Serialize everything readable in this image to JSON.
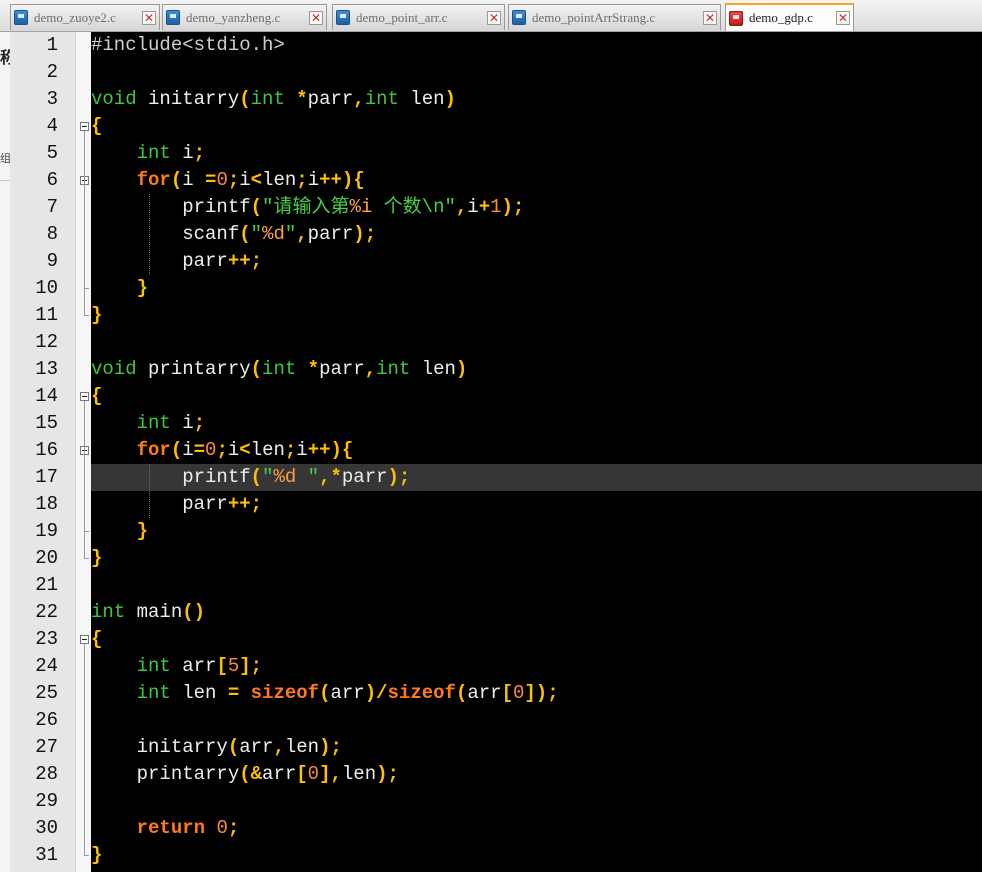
{
  "tabs": [
    {
      "label": "demo_zuoye2.c",
      "icon": "c-file-icon",
      "color": "#2a73bf",
      "active": false
    },
    {
      "label": "demo_yanzheng.c",
      "icon": "c-file-icon",
      "color": "#2a73bf",
      "active": false
    },
    {
      "label": "demo_point_arr.c",
      "icon": "c-file-icon",
      "color": "#2a73bf",
      "active": false
    },
    {
      "label": "demo_pointArrStrang.c",
      "icon": "c-file-icon",
      "color": "#2a73bf",
      "active": false
    },
    {
      "label": "demo_gdp.c",
      "icon": "c-file-icon-modified",
      "color": "#d22b2b",
      "active": true
    }
  ],
  "editor": {
    "current_line": 17,
    "theme": {
      "background": "#000000",
      "type": "#3ec73e",
      "keyword": "#ff7a1a",
      "operator": "#ffc000",
      "number": "#ff8a3a",
      "string": "#46d046"
    },
    "lines": [
      {
        "n": "1",
        "tokens": [
          [
            "#include<stdio.h>",
            "pp"
          ]
        ]
      },
      {
        "n": "2",
        "tokens": []
      },
      {
        "n": "3",
        "tokens": [
          [
            "void",
            "ty"
          ],
          [
            " initarry",
            "id"
          ],
          [
            "(",
            "op"
          ],
          [
            "int",
            "ty"
          ],
          [
            " ",
            "id"
          ],
          [
            "*",
            "op"
          ],
          [
            "parr",
            "id"
          ],
          [
            ",",
            "op"
          ],
          [
            "int",
            "ty"
          ],
          [
            " len",
            "id"
          ],
          [
            ")",
            "op"
          ]
        ]
      },
      {
        "n": "4",
        "tokens": [
          [
            "{",
            "op"
          ]
        ]
      },
      {
        "n": "5",
        "tokens": [
          [
            "    ",
            "id"
          ],
          [
            "int",
            "ty"
          ],
          [
            " i",
            "id"
          ],
          [
            ";",
            "op"
          ]
        ]
      },
      {
        "n": "6",
        "tokens": [
          [
            "    ",
            "id"
          ],
          [
            "for",
            "kw"
          ],
          [
            "(",
            "op"
          ],
          [
            "i ",
            "id"
          ],
          [
            "=",
            "op"
          ],
          [
            "0",
            "nm"
          ],
          [
            ";",
            "op"
          ],
          [
            "i",
            "id"
          ],
          [
            "<",
            "op"
          ],
          [
            "len",
            "id"
          ],
          [
            ";",
            "op"
          ],
          [
            "i",
            "id"
          ],
          [
            "++",
            "op"
          ],
          [
            ")",
            "op"
          ],
          [
            "{",
            "op"
          ]
        ]
      },
      {
        "n": "7",
        "tokens": [
          [
            "        printf",
            "id"
          ],
          [
            "(",
            "op"
          ],
          [
            "\"请输入第",
            "st"
          ],
          [
            "%i",
            "sf"
          ],
          [
            " 个数\\n\"",
            "st"
          ],
          [
            ",",
            "op"
          ],
          [
            "i",
            "id"
          ],
          [
            "+",
            "op"
          ],
          [
            "1",
            "nm"
          ],
          [
            ")",
            "op"
          ],
          [
            ";",
            "op"
          ]
        ]
      },
      {
        "n": "8",
        "tokens": [
          [
            "        scanf",
            "id"
          ],
          [
            "(",
            "op"
          ],
          [
            "\"",
            "st"
          ],
          [
            "%d",
            "sf"
          ],
          [
            "\"",
            "st"
          ],
          [
            ",",
            "op"
          ],
          [
            "parr",
            "id"
          ],
          [
            ")",
            "op"
          ],
          [
            ";",
            "op"
          ]
        ]
      },
      {
        "n": "9",
        "tokens": [
          [
            "        parr",
            "id"
          ],
          [
            "++",
            "op"
          ],
          [
            ";",
            "op"
          ]
        ]
      },
      {
        "n": "10",
        "tokens": [
          [
            "    ",
            "id"
          ],
          [
            "}",
            "op"
          ]
        ]
      },
      {
        "n": "11",
        "tokens": [
          [
            "}",
            "op"
          ]
        ]
      },
      {
        "n": "12",
        "tokens": []
      },
      {
        "n": "13",
        "tokens": [
          [
            "void",
            "ty"
          ],
          [
            " printarry",
            "id"
          ],
          [
            "(",
            "op"
          ],
          [
            "int",
            "ty"
          ],
          [
            " ",
            "id"
          ],
          [
            "*",
            "op"
          ],
          [
            "parr",
            "id"
          ],
          [
            ",",
            "op"
          ],
          [
            "int",
            "ty"
          ],
          [
            " len",
            "id"
          ],
          [
            ")",
            "op"
          ]
        ]
      },
      {
        "n": "14",
        "tokens": [
          [
            "{",
            "op"
          ]
        ]
      },
      {
        "n": "15",
        "tokens": [
          [
            "    ",
            "id"
          ],
          [
            "int",
            "ty"
          ],
          [
            " i",
            "id"
          ],
          [
            ";",
            "op"
          ]
        ]
      },
      {
        "n": "16",
        "tokens": [
          [
            "    ",
            "id"
          ],
          [
            "for",
            "kw"
          ],
          [
            "(",
            "op"
          ],
          [
            "i",
            "id"
          ],
          [
            "=",
            "op"
          ],
          [
            "0",
            "nm"
          ],
          [
            ";",
            "op"
          ],
          [
            "i",
            "id"
          ],
          [
            "<",
            "op"
          ],
          [
            "len",
            "id"
          ],
          [
            ";",
            "op"
          ],
          [
            "i",
            "id"
          ],
          [
            "++",
            "op"
          ],
          [
            ")",
            "op"
          ],
          [
            "{",
            "op"
          ]
        ]
      },
      {
        "n": "17",
        "tokens": [
          [
            "        printf",
            "id"
          ],
          [
            "(",
            "op"
          ],
          [
            "\"",
            "st"
          ],
          [
            "%d",
            "sf"
          ],
          [
            " \"",
            "st"
          ],
          [
            ",",
            "op"
          ],
          [
            "*",
            "op"
          ],
          [
            "parr",
            "id"
          ],
          [
            ")",
            "op"
          ],
          [
            ";",
            "op"
          ]
        ]
      },
      {
        "n": "18",
        "tokens": [
          [
            "        parr",
            "id"
          ],
          [
            "++",
            "op"
          ],
          [
            ";",
            "op"
          ]
        ]
      },
      {
        "n": "19",
        "tokens": [
          [
            "    ",
            "id"
          ],
          [
            "}",
            "op"
          ]
        ]
      },
      {
        "n": "20",
        "tokens": [
          [
            "}",
            "op"
          ]
        ]
      },
      {
        "n": "21",
        "tokens": []
      },
      {
        "n": "22",
        "tokens": [
          [
            "int",
            "ty"
          ],
          [
            " main",
            "id"
          ],
          [
            "()",
            "op"
          ]
        ]
      },
      {
        "n": "23",
        "tokens": [
          [
            "{",
            "op"
          ]
        ]
      },
      {
        "n": "24",
        "tokens": [
          [
            "    ",
            "id"
          ],
          [
            "int",
            "ty"
          ],
          [
            " arr",
            "id"
          ],
          [
            "[",
            "op"
          ],
          [
            "5",
            "nm"
          ],
          [
            "]",
            "op"
          ],
          [
            ";",
            "op"
          ]
        ]
      },
      {
        "n": "25",
        "tokens": [
          [
            "    ",
            "id"
          ],
          [
            "int",
            "ty"
          ],
          [
            " len ",
            "id"
          ],
          [
            "=",
            "op"
          ],
          [
            " ",
            "id"
          ],
          [
            "sizeof",
            "kw"
          ],
          [
            "(",
            "op"
          ],
          [
            "arr",
            "id"
          ],
          [
            ")",
            "op"
          ],
          [
            "/",
            "op"
          ],
          [
            "sizeof",
            "kw"
          ],
          [
            "(",
            "op"
          ],
          [
            "arr",
            "id"
          ],
          [
            "[",
            "op"
          ],
          [
            "0",
            "nm"
          ],
          [
            "]",
            "op"
          ],
          [
            ")",
            "op"
          ],
          [
            ";",
            "op"
          ]
        ]
      },
      {
        "n": "26",
        "tokens": []
      },
      {
        "n": "27",
        "tokens": [
          [
            "    initarry",
            "id"
          ],
          [
            "(",
            "op"
          ],
          [
            "arr",
            "id"
          ],
          [
            ",",
            "op"
          ],
          [
            "len",
            "id"
          ],
          [
            ")",
            "op"
          ],
          [
            ";",
            "op"
          ]
        ]
      },
      {
        "n": "28",
        "tokens": [
          [
            "    printarry",
            "id"
          ],
          [
            "(",
            "op"
          ],
          [
            "&",
            "op"
          ],
          [
            "arr",
            "id"
          ],
          [
            "[",
            "op"
          ],
          [
            "0",
            "nm"
          ],
          [
            "]",
            "op"
          ],
          [
            ",",
            "op"
          ],
          [
            "len",
            "id"
          ],
          [
            ")",
            "op"
          ],
          [
            ";",
            "op"
          ]
        ]
      },
      {
        "n": "29",
        "tokens": []
      },
      {
        "n": "30",
        "tokens": [
          [
            "    ",
            "id"
          ],
          [
            "return",
            "kw"
          ],
          [
            " ",
            "id"
          ],
          [
            "0",
            "nm"
          ],
          [
            ";",
            "op"
          ]
        ]
      },
      {
        "n": "31",
        "tokens": [
          [
            "}",
            "op"
          ]
        ]
      }
    ]
  }
}
